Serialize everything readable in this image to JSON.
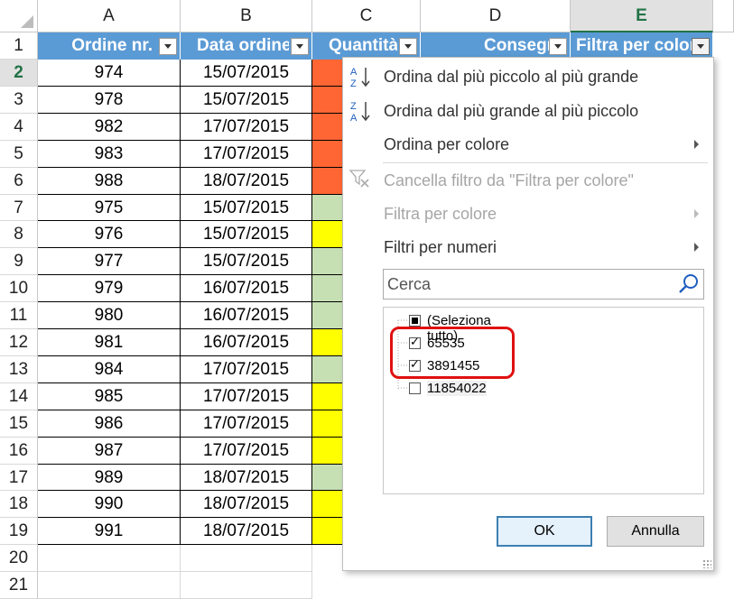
{
  "columns": [
    "A",
    "B",
    "C",
    "D",
    "E"
  ],
  "headers": {
    "a": "Ordine nr.",
    "b": "Data ordine",
    "c": "Quantità",
    "d": "Consegna",
    "e": "Filtra per colore"
  },
  "rows": [
    {
      "n": "2",
      "a": "974",
      "b": "15/07/2015",
      "color": "orange"
    },
    {
      "n": "3",
      "a": "978",
      "b": "15/07/2015",
      "color": "orange"
    },
    {
      "n": "4",
      "a": "982",
      "b": "17/07/2015",
      "color": "orange"
    },
    {
      "n": "5",
      "a": "983",
      "b": "17/07/2015",
      "color": "orange"
    },
    {
      "n": "6",
      "a": "988",
      "b": "18/07/2015",
      "color": "orange"
    },
    {
      "n": "7",
      "a": "975",
      "b": "15/07/2015",
      "color": "green"
    },
    {
      "n": "8",
      "a": "976",
      "b": "15/07/2015",
      "color": "yellow"
    },
    {
      "n": "9",
      "a": "977",
      "b": "15/07/2015",
      "color": "green"
    },
    {
      "n": "10",
      "a": "979",
      "b": "16/07/2015",
      "color": "green"
    },
    {
      "n": "11",
      "a": "980",
      "b": "16/07/2015",
      "color": "green"
    },
    {
      "n": "12",
      "a": "981",
      "b": "16/07/2015",
      "color": "yellow"
    },
    {
      "n": "13",
      "a": "984",
      "b": "17/07/2015",
      "color": "green"
    },
    {
      "n": "14",
      "a": "985",
      "b": "17/07/2015",
      "color": "yellow"
    },
    {
      "n": "15",
      "a": "986",
      "b": "17/07/2015",
      "color": "yellow"
    },
    {
      "n": "16",
      "a": "987",
      "b": "17/07/2015",
      "color": "yellow"
    },
    {
      "n": "17",
      "a": "989",
      "b": "18/07/2015",
      "color": "green"
    },
    {
      "n": "18",
      "a": "990",
      "b": "18/07/2015",
      "color": "yellow"
    },
    {
      "n": "19",
      "a": "991",
      "b": "18/07/2015",
      "color": "yellow"
    }
  ],
  "extra_rows": [
    "1",
    "20",
    "21"
  ],
  "menu": {
    "sort_asc": "Ordina dal più piccolo al più grande",
    "sort_desc": "Ordina dal più grande al più piccolo",
    "sort_color": "Ordina per colore",
    "clear_filter": "Cancella filtro da \"Filtra per colore\"",
    "filter_color": "Filtra per colore",
    "filter_numbers": "Filtri per numeri",
    "search_placeholder": "Cerca",
    "items": [
      {
        "label": "(Seleziona tutto)",
        "state": "partial"
      },
      {
        "label": "65535",
        "state": "checked"
      },
      {
        "label": "3891455",
        "state": "checked"
      },
      {
        "label": "11854022",
        "state": "unchecked"
      }
    ],
    "ok": "OK",
    "cancel": "Annulla"
  },
  "colors": {
    "orange": "#ff6633",
    "green": "#c6e0b4",
    "yellow": "#ffff00",
    "header": "#5b9bd5",
    "highlight": "#e01010"
  }
}
